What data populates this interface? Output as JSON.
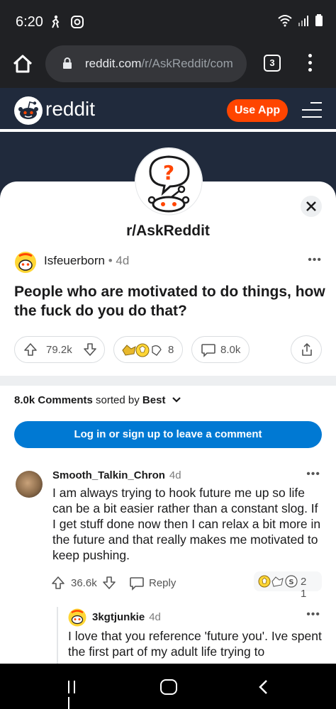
{
  "status_bar": {
    "time": "6:20",
    "left_icons": [
      "person-run-icon",
      "instagram-icon"
    ],
    "right_icons": [
      "wifi-icon",
      "signal-icon",
      "battery-icon"
    ]
  },
  "browser": {
    "url_host": "reddit.com",
    "url_path": "/r/AskReddit/com",
    "tab_count": "3"
  },
  "header": {
    "brand": "reddit",
    "use_app_label": "Use App",
    "brand_color": "#ff4500"
  },
  "subreddit": {
    "name": "r/AskReddit"
  },
  "post": {
    "author": "Isfeuerborn",
    "separator": "•",
    "time": "4d",
    "more": "•••",
    "title": "People who are motivated to do things, how the fuck do you do that?",
    "score": "79.2k",
    "award_count": "8",
    "comment_count": "8.0k"
  },
  "comments_header": {
    "count": "8.0k Comments",
    "sorted_by": "sorted by",
    "sort_value": "Best"
  },
  "login_prompt": {
    "label": "Log in or sign up to leave a comment",
    "color": "#0079d3"
  },
  "comments": [
    {
      "author": "Smooth_Talkin_Chron",
      "time": "4d",
      "body": "I am always trying to hook future me up so life can be a bit easier rather than a constant slog. If I get stuff done now then I can relax a bit more in the future and that really makes me motivated to keep pushing.",
      "score": "36.6k",
      "reply_label": "Reply",
      "award_count": "2 1",
      "more": "•••"
    },
    {
      "author": "3kgtjunkie",
      "time": "4d",
      "body": "I love that you reference 'future you'. Ive spent the first part of my adult life trying to",
      "more": "•••"
    }
  ]
}
